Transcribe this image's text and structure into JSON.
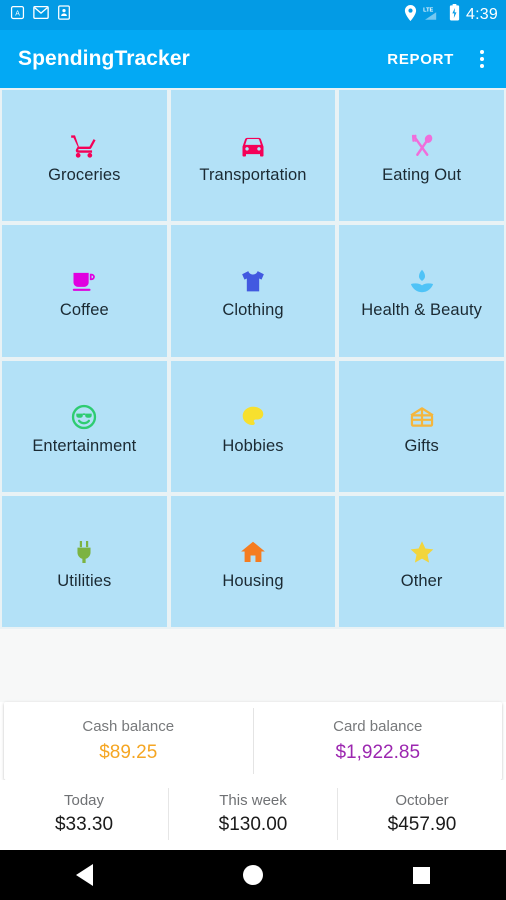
{
  "status_bar": {
    "background": "#039BE5",
    "left_icons": [
      "app-badge-icon",
      "gmail-icon",
      "contacts-card-icon"
    ],
    "right_icons": [
      "location-pin-icon",
      "lte-signal-icon",
      "battery-charging-icon"
    ],
    "network_label": "LTE",
    "time": "4:39"
  },
  "app_bar": {
    "background": "#03A9F4",
    "title": "SpendingTracker",
    "report_label": "REPORT",
    "overflow_name": "more-options-icon"
  },
  "grid": {
    "tile_background": "#b3e1f7",
    "tiles": [
      {
        "label": "Groceries",
        "icon": "shopping-cart-icon",
        "color": "#F50057"
      },
      {
        "label": "Transportation",
        "icon": "car-icon",
        "color": "#F50057"
      },
      {
        "label": "Eating Out",
        "icon": "fork-spoon-icon",
        "color": "#F06EDB"
      },
      {
        "label": "Coffee",
        "icon": "coffee-cup-icon",
        "color": "#E000E0"
      },
      {
        "label": "Clothing",
        "icon": "tshirt-icon",
        "color": "#4259E0"
      },
      {
        "label": "Health & Beauty",
        "icon": "spa-lotus-icon",
        "color": "#4FC3F7"
      },
      {
        "label": "Entertainment",
        "icon": "smiley-sunglasses-icon",
        "color": "#2ECC71"
      },
      {
        "label": "Hobbies",
        "icon": "palette-icon",
        "color": "#F7E02E"
      },
      {
        "label": "Gifts",
        "icon": "gift-box-icon",
        "color": "#F5B63C"
      },
      {
        "label": "Utilities",
        "icon": "power-plug-icon",
        "color": "#7CB342"
      },
      {
        "label": "Housing",
        "icon": "home-icon",
        "color": "#F57C20"
      },
      {
        "label": "Other",
        "icon": "star-icon",
        "color": "#F2D53C"
      }
    ]
  },
  "balances": [
    {
      "label": "Cash balance",
      "value": "$89.25",
      "color": "#F5A623"
    },
    {
      "label": "Card balance",
      "value": "$1,922.85",
      "color": "#9C27B0"
    }
  ],
  "summary": [
    {
      "label": "Today",
      "value": "$33.30"
    },
    {
      "label": "This week",
      "value": "$130.00"
    },
    {
      "label": "October",
      "value": "$457.90"
    }
  ],
  "nav_bar": {
    "back": "back-triangle-icon",
    "home": "home-circle-icon",
    "recents": "recents-square-icon"
  }
}
